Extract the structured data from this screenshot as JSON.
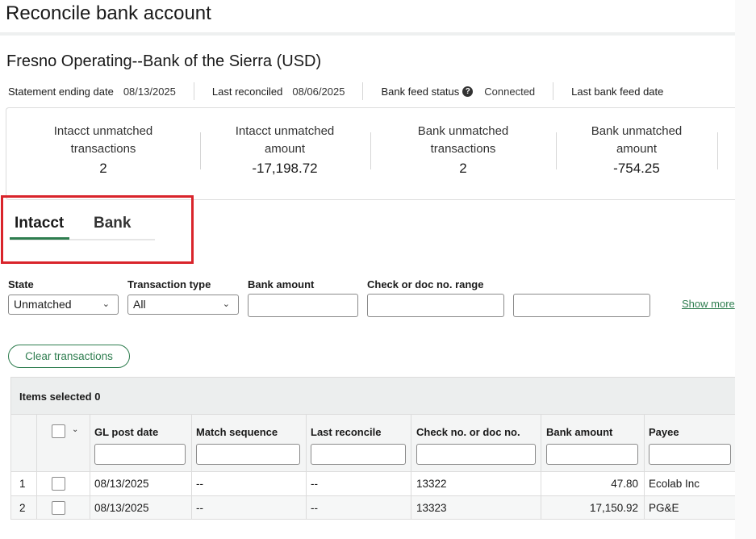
{
  "page": {
    "title": "Reconcile bank account",
    "account_title": "Fresno Operating--Bank of the Sierra (USD)"
  },
  "meta": {
    "statement_label": "Statement ending date",
    "statement_value": "08/13/2025",
    "last_reconciled_label": "Last reconciled",
    "last_reconciled_value": "08/06/2025",
    "feed_status_label": "Bank feed status",
    "feed_status_value": "Connected",
    "last_feed_label": "Last bank feed date"
  },
  "summary": [
    {
      "label_line1": "Intacct unmatched",
      "label_line2": "transactions",
      "value": "2"
    },
    {
      "label_line1": "Intacct unmatched",
      "label_line2": "amount",
      "value": "-17,198.72"
    },
    {
      "label_line1": "Bank unmatched",
      "label_line2": "transactions",
      "value": "2"
    },
    {
      "label_line1": "Bank unmatched",
      "label_line2": "amount",
      "value": "-754.25"
    }
  ],
  "tabs": [
    {
      "label": "Intacct",
      "active": true
    },
    {
      "label": "Bank",
      "active": false
    }
  ],
  "filters": {
    "state_label": "State",
    "state_value": "Unmatched",
    "type_label": "Transaction type",
    "type_value": "All",
    "amount_label": "Bank amount",
    "range_label": "Check or doc no. range",
    "show_more": "Show more"
  },
  "actions": {
    "clear_label": "Clear transactions"
  },
  "table": {
    "items_selected": "Items selected 0",
    "columns": [
      "GL post date",
      "Match sequence",
      "Last reconcile",
      "Check no. or doc no.",
      "Bank amount",
      "Payee"
    ],
    "rows": [
      {
        "num": "1",
        "gl_date": "08/13/2025",
        "match_seq": "--",
        "last_rec": "--",
        "doc_no": "13322",
        "amount": "47.80",
        "payee": "Ecolab Inc"
      },
      {
        "num": "2",
        "gl_date": "08/13/2025",
        "match_seq": "--",
        "last_rec": "--",
        "doc_no": "13323",
        "amount": "17,150.92",
        "payee": "PG&E"
      }
    ]
  },
  "colors": {
    "accent": "#2e7d4f",
    "highlight": "#d9242b"
  }
}
